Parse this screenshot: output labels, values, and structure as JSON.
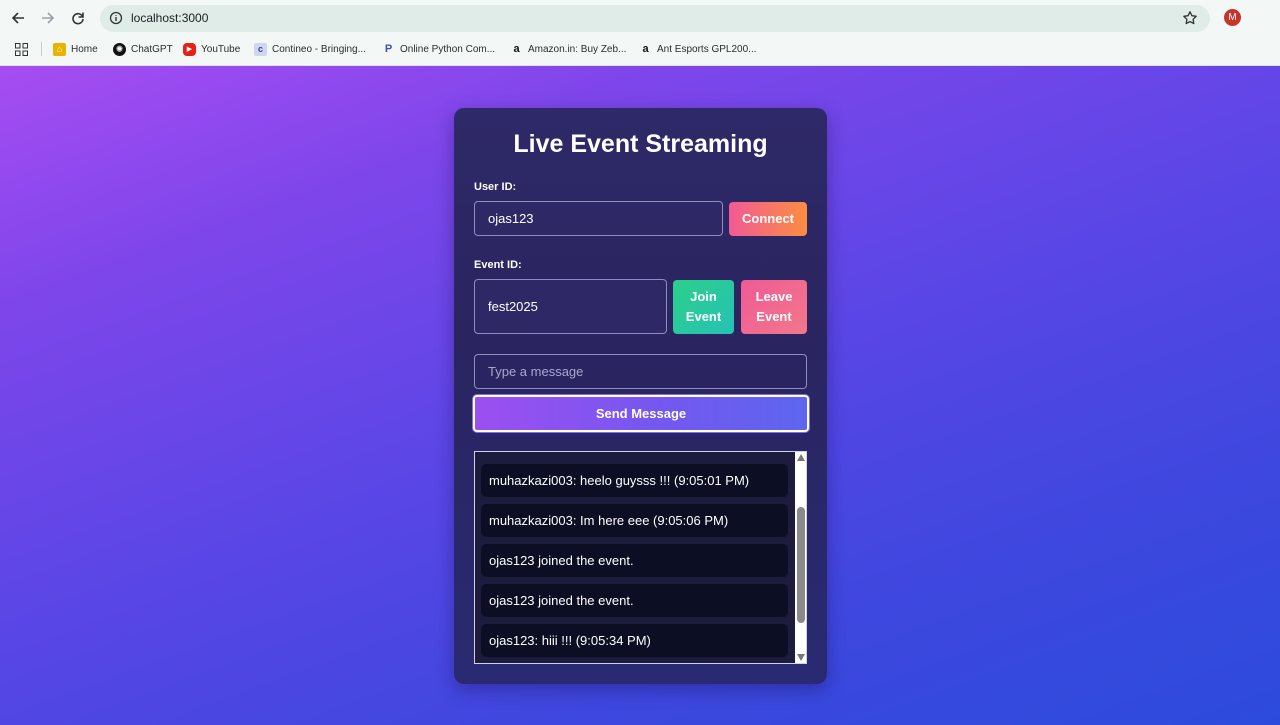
{
  "browser": {
    "url": "localhost:3000",
    "profile_initial": "M",
    "bookmarks": [
      {
        "label": "Home",
        "icon": "home-icon"
      },
      {
        "label": "ChatGPT",
        "icon": "chatgpt-icon"
      },
      {
        "label": "YouTube",
        "icon": "youtube-icon"
      },
      {
        "label": "Contineo - Bringing...",
        "icon": "contineo-icon"
      },
      {
        "label": "Online Python Com...",
        "icon": "python-compiler-icon"
      },
      {
        "label": "Amazon.in: Buy Zeb...",
        "icon": "amazon-icon"
      },
      {
        "label": "Ant Esports GPL200...",
        "icon": "amazon-icon"
      }
    ]
  },
  "app": {
    "title": "Live Event Streaming",
    "user_id_label": "User ID:",
    "user_id_value": "ojas123",
    "connect_label": "Connect",
    "event_id_label": "Event ID:",
    "event_id_value": "fest2025",
    "join_label": "Join Event",
    "leave_label": "Leave Event",
    "message_placeholder": "Type a message",
    "send_label": "Send Message",
    "messages": [
      "muhazkazi003: heelo guysss !!! (9:05:01 PM)",
      "muhazkazi003: Im here eee (9:05:06 PM)",
      "ojas123 joined the event.",
      "ojas123 joined the event.",
      "ojas123: hiii !!! (9:05:34 PM)"
    ]
  },
  "colors": {
    "page_gradient_start": "#a64df2",
    "page_gradient_end": "#2c4bdc",
    "card_bg": "#2a2560",
    "connect_gradient": [
      "#f25a95",
      "#fb8e40"
    ],
    "join_gradient": [
      "#2ccf8a",
      "#26c2b6"
    ],
    "leave_gradient": [
      "#f05a95",
      "#f2788a"
    ],
    "send_gradient": [
      "#9c4ff1",
      "#5d66ee"
    ],
    "message_bg": "#0c0f24"
  }
}
